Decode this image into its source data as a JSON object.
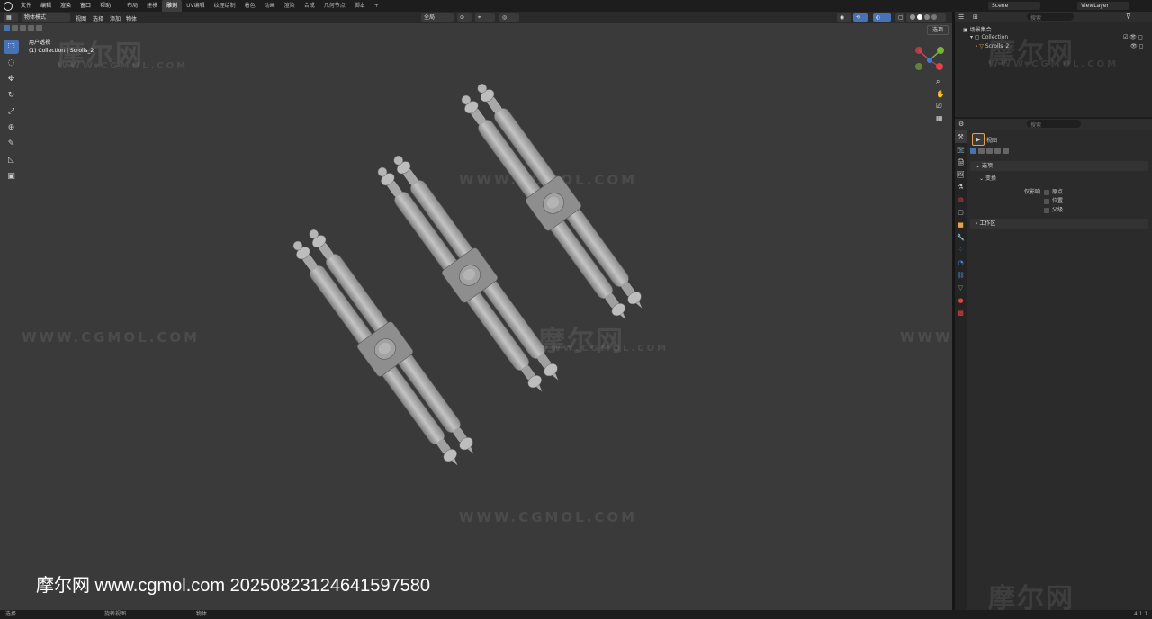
{
  "topbar": {
    "menus": [
      "文件",
      "编辑",
      "渲染",
      "窗口",
      "帮助"
    ],
    "workspaces": [
      "布局",
      "建模",
      "雕刻",
      "UV编辑",
      "纹理绘制",
      "着色",
      "动画",
      "渲染",
      "合成",
      "几何节点",
      "脚本",
      "+"
    ],
    "active_workspace_index": 2,
    "scene": "Scene",
    "view_layer": "ViewLayer"
  },
  "viewport_header": {
    "mode": "物体模式",
    "menus": [
      "视图",
      "选择",
      "添加",
      "物体"
    ],
    "transform_orientation": "全局",
    "options_label": "选项"
  },
  "viewport": {
    "view_name": "用户透视",
    "collection_info": "(1) Collection | Scrolls_2"
  },
  "outliner": {
    "search_placeholder": "搜索",
    "scene_collection": "场景集合",
    "collection": "Collection",
    "object": "Scrolls_2"
  },
  "properties": {
    "search_placeholder": "搜索",
    "header": "视图",
    "panel_options": "选项",
    "subpanel_transform": "变换",
    "affect_only_label": "仅影响",
    "affect_only_items": [
      "原点",
      "位置",
      "父级"
    ],
    "panel_workspace": "工作区"
  },
  "status_bar": {
    "select": "选择",
    "rotate_view": "旋转视图",
    "object_menu": "物体",
    "version": "4.1.1"
  },
  "watermarks": {
    "cn": "摩尔网",
    "url": "WWW.CGMOL.COM",
    "caption": "摩尔网 www.cgmol.com 20250823124641597580"
  },
  "colors": {
    "accent": "#4772b3",
    "viewport_bg": "#3a3a3a",
    "axis_x": "#e2404a",
    "axis_y": "#79b43a",
    "axis_z": "#3c7fd4"
  }
}
